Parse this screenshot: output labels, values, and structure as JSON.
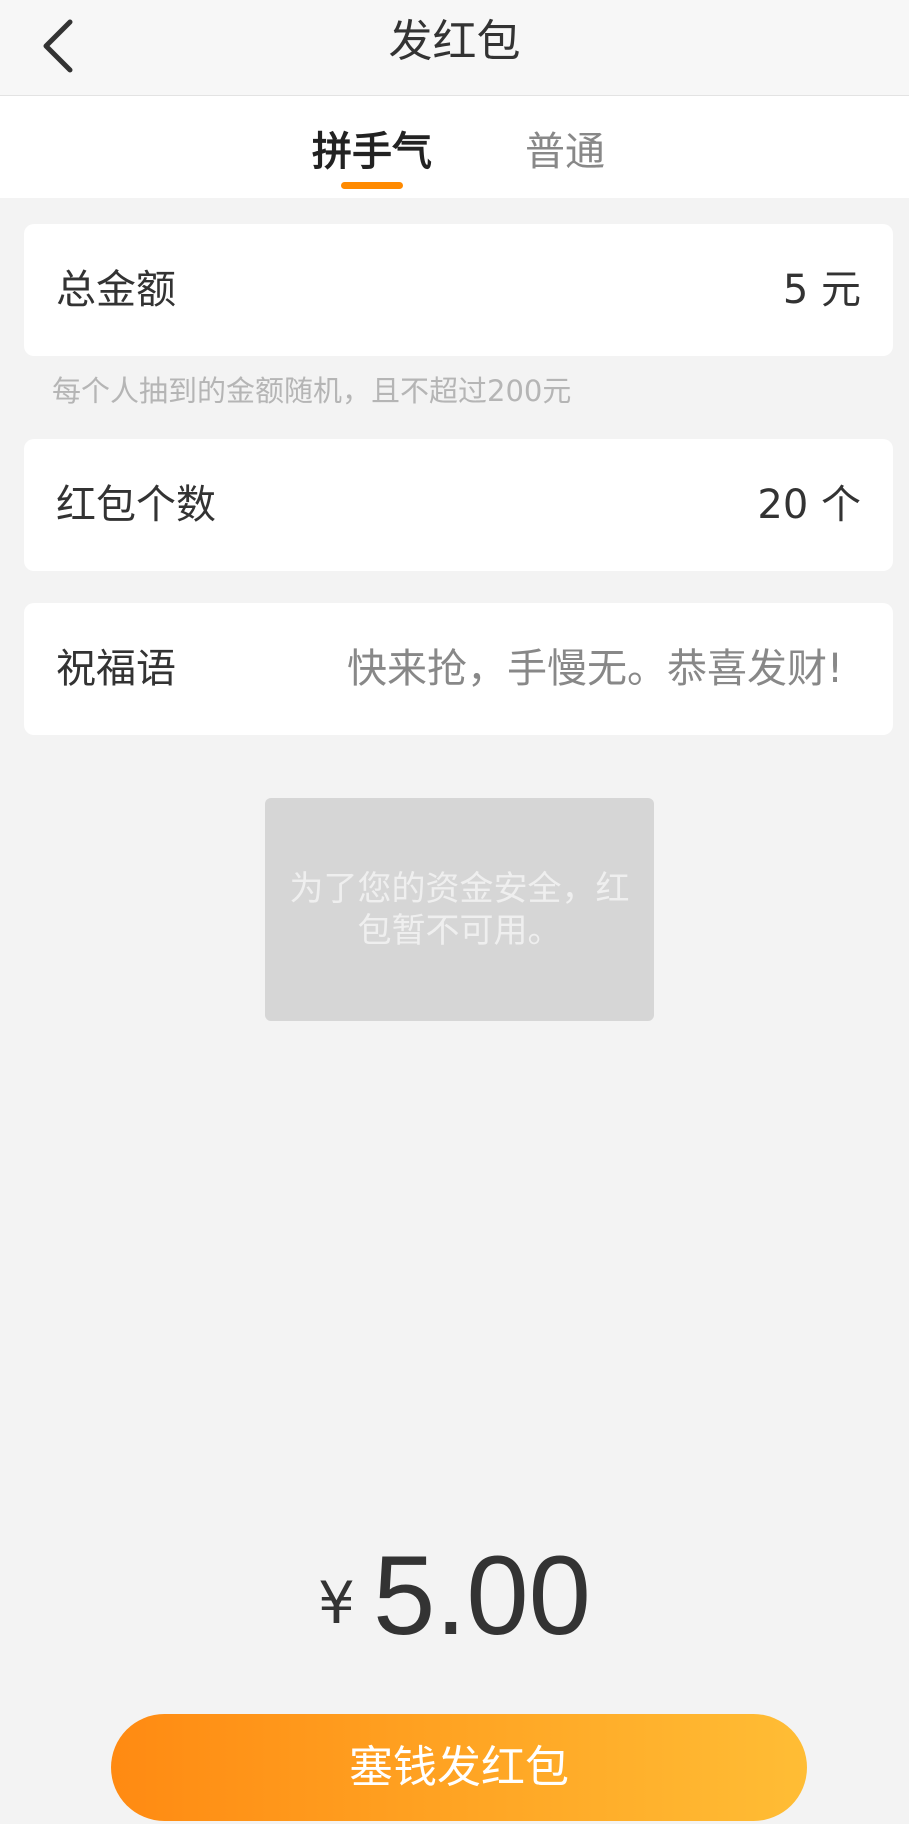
{
  "header": {
    "title": "发红包",
    "back_icon": "chevron-left-icon"
  },
  "tabs": [
    {
      "label": "拼手气",
      "active": true
    },
    {
      "label": "普通",
      "active": false
    }
  ],
  "form": {
    "total_amount": {
      "label": "总金额",
      "value": "5 元"
    },
    "hint": "每个人抽到的金额随机，且不超过200元",
    "count": {
      "label": "红包个数",
      "value": "20 个"
    },
    "greeting": {
      "label": "祝福语",
      "value": "快来抢，手慢无。恭喜发财!"
    }
  },
  "toast": {
    "message": "为了您的资金安全，红包暂不可用。"
  },
  "total": {
    "symbol": "¥",
    "value": "5.00"
  },
  "send_button": {
    "label": "塞钱发红包"
  },
  "colors": {
    "accent": "#ff8a00",
    "button_gradient_start": "#ff8a12",
    "button_gradient_end": "#ffbd35",
    "background": "#f3f3f3"
  }
}
